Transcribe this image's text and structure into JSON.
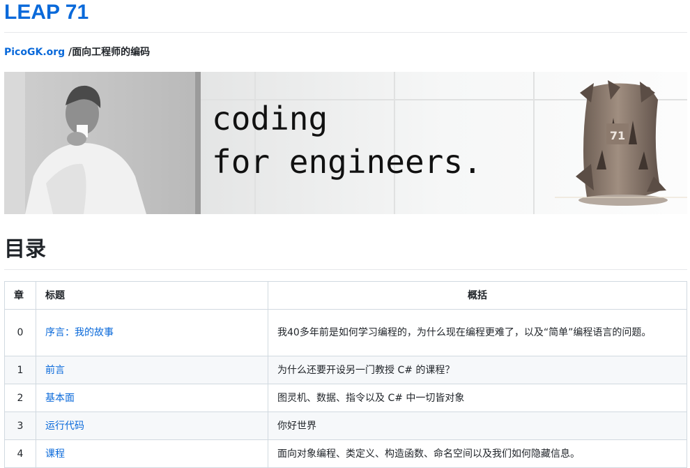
{
  "site": {
    "title": "LEAP 71"
  },
  "breadcrumb": {
    "link": "PicoGK.org",
    "separator": " /",
    "current": "面向工程师的编码"
  },
  "banner": {
    "line1": "coding",
    "line2": "for engineers.",
    "logo_mark": "71"
  },
  "toc": {
    "heading": "目录",
    "columns": [
      "章",
      "标题",
      "概括"
    ],
    "rows": [
      {
        "chapter": "0",
        "title": "序言：我的故事",
        "summary": "我40多年前是如何学习编程的，为什么现在编程更难了，以及“简单”编程语言的问题。"
      },
      {
        "chapter": "1",
        "title": "前言",
        "summary": "为什么还要开设另一门教授 C# 的课程？"
      },
      {
        "chapter": "2",
        "title": "基本面",
        "summary": "图灵机、数据、指令以及 C# 中一切皆对象"
      },
      {
        "chapter": "3",
        "title": "运行代码",
        "summary": "你好世界"
      },
      {
        "chapter": "4",
        "title": "课程",
        "summary": "面向对象编程、类定义、构造函数、命名空间以及我们如何隐藏信息。"
      }
    ]
  },
  "colors": {
    "link": "#0969da",
    "text": "#1f2328",
    "border": "#d1d9e0",
    "row_alt": "#f6f8fa"
  }
}
